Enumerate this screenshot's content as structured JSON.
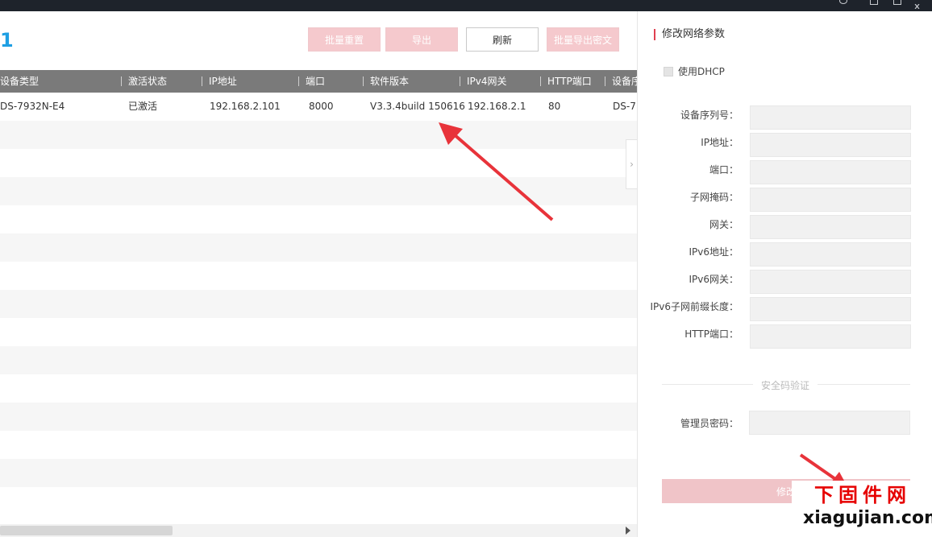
{
  "device_count": "1",
  "toolbar": {
    "batch_reset": "批量重置",
    "export": "导出",
    "refresh": "刷新",
    "batch_export_cipher": "批量导出密文"
  },
  "table": {
    "columns": [
      "设备类型",
      "激活状态",
      "IP地址",
      "端口",
      "软件版本",
      "IPv4网关",
      "HTTP端口",
      "设备序"
    ],
    "rows": [
      [
        "DS-7932N-E4",
        "已激活",
        "192.168.2.101",
        "8000",
        "V3.3.4build 150616",
        "192.168.2.1",
        "80",
        "DS-7"
      ]
    ]
  },
  "panel": {
    "title": "修改网络参数",
    "dhcp_label": "使用DHCP",
    "fields": {
      "serial": "设备序列号：",
      "ip": "IP地址：",
      "port": "端口：",
      "mask": "子网掩码：",
      "gateway": "网关：",
      "ipv6": "IPv6地址：",
      "ipv6_gateway": "IPv6网关：",
      "ipv6_prefix": "IPv6子网前缀长度：",
      "http_port": "HTTP端口："
    },
    "security_label": "安全码验证",
    "admin_password_label": "管理员密码：",
    "submit_label": "修改"
  },
  "watermark": {
    "cn": "下固件网",
    "url": "xiagujian.com"
  },
  "colors": {
    "accent_blue": "#1e9fe3",
    "header_gray": "#7a7a7a",
    "disabled_pink": "#f5c9cd",
    "arrow_red": "#e8333a"
  }
}
